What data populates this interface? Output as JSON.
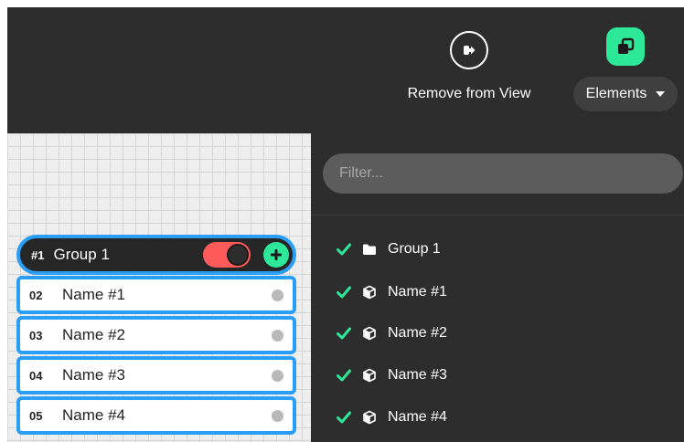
{
  "toolbar": {
    "remove_label": "Remove from View",
    "elements_label": "Elements"
  },
  "canvas": {
    "group": {
      "number": "#1",
      "name": "Group 1",
      "visibility_on": true
    },
    "items": [
      {
        "number": "02",
        "name": "Name #1"
      },
      {
        "number": "03",
        "name": "Name #2"
      },
      {
        "number": "04",
        "name": "Name #3"
      },
      {
        "number": "05",
        "name": "Name #4"
      }
    ]
  },
  "panel": {
    "filter_placeholder": "Filter...",
    "rows": [
      {
        "label": "Group 1",
        "icon": "folder-icon",
        "checked": true
      },
      {
        "label": "Name #1",
        "icon": "cube-icon",
        "checked": true
      },
      {
        "label": "Name #2",
        "icon": "cube-icon",
        "checked": true
      },
      {
        "label": "Name #3",
        "icon": "cube-icon",
        "checked": true
      },
      {
        "label": "Name #4",
        "icon": "cube-icon",
        "checked": true
      }
    ]
  },
  "colors": {
    "accent_green": "#2ee89a",
    "selection_blue": "#2a9df4",
    "toggle_red": "#ff5b5b",
    "dark_bg": "#2d2d2d"
  }
}
